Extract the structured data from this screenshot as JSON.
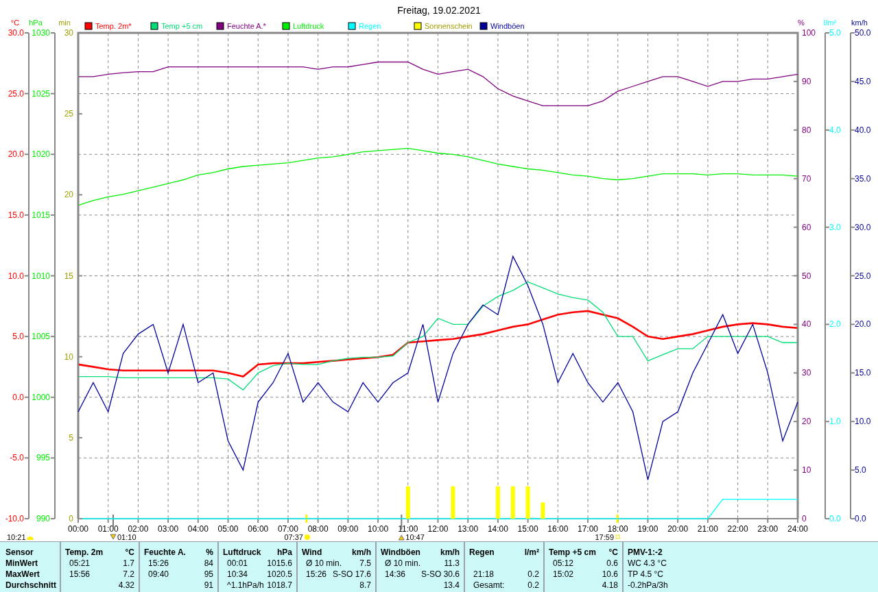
{
  "charts": [
    {
      "chart_data": {
        "type": "line",
        "title": "Freitag, 19.02.2021",
        "ylabel": "°C",
        "x": [
          0,
          0.5,
          1,
          1.5,
          2,
          2.5,
          3,
          3.5,
          4,
          4.5,
          5,
          5.5,
          6,
          6.5,
          7,
          7.5,
          8,
          8.5,
          9,
          9.5,
          10,
          10.5,
          11,
          11.5,
          12,
          12.5,
          13,
          13.5,
          14,
          14.5,
          15,
          15.5,
          16,
          16.5,
          17,
          17.5,
          18,
          18.5,
          19,
          19.5,
          20,
          20.5,
          21,
          21.5,
          22,
          22.5,
          23,
          23.5,
          24
        ],
        "xlim": [
          0,
          24
        ],
        "xticks": [
          {
            "value": 0,
            "label": "00:00"
          },
          {
            "value": 1,
            "label": "01:00"
          },
          {
            "value": 2,
            "label": "02:00"
          },
          {
            "value": 3,
            "label": "03:00"
          },
          {
            "value": 4,
            "label": "04:00"
          },
          {
            "value": 5,
            "label": "05:00"
          },
          {
            "value": 6,
            "label": "06:00"
          },
          {
            "value": 7,
            "label": "07:00"
          },
          {
            "value": 8,
            "label": "08:00"
          },
          {
            "value": 9,
            "label": "09:00"
          },
          {
            "value": 10,
            "label": "10:00"
          },
          {
            "value": 11,
            "label": "11:00"
          },
          {
            "value": 12,
            "label": "12:00"
          },
          {
            "value": 13,
            "label": "13:00"
          },
          {
            "value": 14,
            "label": "14:00"
          },
          {
            "value": 15,
            "label": "15:00"
          },
          {
            "value": 16,
            "label": "16:00"
          },
          {
            "value": 17,
            "label": "17:00"
          },
          {
            "value": 18,
            "label": "18:00"
          },
          {
            "value": 19,
            "label": "19:00"
          },
          {
            "value": 20,
            "label": "20:00"
          },
          {
            "value": 21,
            "label": "21:00"
          },
          {
            "value": 22,
            "label": "22:00"
          },
          {
            "value": 23,
            "label": "23:00"
          },
          {
            "value": 24,
            "label": "24:00"
          }
        ],
        "ylim": [
          -10,
          30
        ],
        "yticks": [
          {
            "value": -10,
            "label": "-10.0"
          },
          {
            "value": -5,
            "label": "-5.0"
          },
          {
            "value": 0,
            "label": "0.0"
          },
          {
            "value": 5,
            "label": "5.0"
          },
          {
            "value": 10,
            "label": "10.0"
          },
          {
            "value": 15,
            "label": "15.0"
          },
          {
            "value": 20,
            "label": "20.0"
          },
          {
            "value": 25,
            "label": "25.0"
          },
          {
            "value": 30,
            "label": "30.0"
          }
        ],
        "series": [
          {
            "name": "Temp. 2m*",
            "color": "#ff0000",
            "values": [
              2.7,
              2.5,
              2.3,
              2.2,
              2.2,
              2.2,
              2.2,
              2.2,
              2.2,
              2.2,
              2.0,
              1.7,
              2.7,
              2.8,
              2.8,
              2.8,
              2.9,
              3.0,
              3.1,
              3.2,
              3.3,
              3.5,
              4.5,
              4.6,
              4.7,
              4.8,
              5.0,
              5.2,
              5.5,
              5.8,
              6.0,
              6.4,
              6.8,
              7.0,
              7.1,
              6.8,
              6.5,
              5.8,
              5.0,
              4.8,
              5.0,
              5.2,
              5.5,
              5.8,
              6.0,
              6.1,
              6.0,
              5.8,
              5.7
            ]
          },
          {
            "name": "Temp +5 cm",
            "color": "#00dd77",
            "values": [
              1.7,
              1.7,
              1.7,
              1.6,
              1.6,
              1.6,
              1.6,
              1.6,
              1.6,
              1.6,
              1.5,
              0.6,
              2.0,
              2.6,
              2.8,
              2.7,
              2.7,
              3.0,
              3.2,
              3.3,
              3.3,
              3.4,
              4.5,
              5.0,
              6.5,
              6.0,
              6.0,
              7.5,
              8.3,
              8.8,
              9.5,
              9.0,
              8.5,
              8.2,
              8.0,
              7.0,
              5.0,
              5.0,
              3.0,
              3.5,
              4.0,
              4.0,
              5.0,
              5.0,
              5.0,
              5.0,
              5.0,
              4.5,
              4.5
            ]
          }
        ],
        "grid": true,
        "legend": "top"
      }
    },
    {
      "chart_data": {
        "type": "line",
        "ylabel": "%",
        "x": [
          0,
          0.5,
          1,
          1.5,
          2,
          2.5,
          3,
          3.5,
          4,
          4.5,
          5,
          5.5,
          6,
          6.5,
          7,
          7.5,
          8,
          8.5,
          9,
          9.5,
          10,
          10.5,
          11,
          11.5,
          12,
          12.5,
          13,
          13.5,
          14,
          14.5,
          15,
          15.5,
          16,
          16.5,
          17,
          17.5,
          18,
          18.5,
          19,
          19.5,
          20,
          20.5,
          21,
          21.5,
          22,
          22.5,
          23,
          23.5,
          24
        ],
        "xlim": [
          0,
          24
        ],
        "ylim": [
          0,
          100
        ],
        "yticks": [
          0,
          10,
          20,
          30,
          40,
          50,
          60,
          70,
          80,
          90,
          100
        ],
        "series": [
          {
            "name": "Feuchte A.*",
            "color": "#800080",
            "values": [
              91,
              91,
              91.5,
              91.8,
              92,
              92,
              93,
              93,
              93,
              93,
              93,
              93,
              93,
              93,
              93,
              93,
              92.5,
              93,
              93,
              93.5,
              94,
              94,
              94,
              92.5,
              91.5,
              92,
              92.5,
              91,
              88.5,
              87,
              86,
              85,
              85,
              85,
              85,
              86,
              88,
              89,
              90,
              91,
              91,
              90,
              89,
              90,
              90,
              90.5,
              90.5,
              91,
              91.5
            ]
          }
        ]
      }
    },
    {
      "chart_data": {
        "type": "line",
        "ylabel": "hPa",
        "x": [
          0,
          0.5,
          1,
          1.5,
          2,
          2.5,
          3,
          3.5,
          4,
          4.5,
          5,
          5.5,
          6,
          6.5,
          7,
          7.5,
          8,
          8.5,
          9,
          9.5,
          10,
          10.5,
          11,
          11.5,
          12,
          12.5,
          13,
          13.5,
          14,
          14.5,
          15,
          15.5,
          16,
          16.5,
          17,
          17.5,
          18,
          18.5,
          19,
          19.5,
          20,
          20.5,
          21,
          21.5,
          22,
          22.5,
          23,
          23.5,
          24
        ],
        "xlim": [
          0,
          24
        ],
        "ylim": [
          990,
          1030
        ],
        "yticks": [
          990,
          995,
          1000,
          1005,
          1010,
          1015,
          1020,
          1025,
          1030
        ],
        "series": [
          {
            "name": "Luftdruck",
            "color": "#00ee00",
            "values": [
              1015.8,
              1016.2,
              1016.5,
              1016.7,
              1017,
              1017.3,
              1017.6,
              1017.9,
              1018.3,
              1018.5,
              1018.8,
              1019,
              1019.1,
              1019.2,
              1019.3,
              1019.5,
              1019.7,
              1019.8,
              1020,
              1020.2,
              1020.3,
              1020.4,
              1020.5,
              1020.3,
              1020.1,
              1020,
              1019.8,
              1019.5,
              1019.2,
              1019,
              1018.8,
              1018.7,
              1018.5,
              1018.3,
              1018.2,
              1018,
              1017.9,
              1018,
              1018.2,
              1018.4,
              1018.4,
              1018.4,
              1018.3,
              1018.4,
              1018.4,
              1018.3,
              1018.3,
              1018.3,
              1018.2
            ]
          }
        ]
      }
    },
    {
      "chart_data": {
        "type": "line",
        "ylabel": "l/m²",
        "x": [
          0,
          0.5,
          1,
          1.5,
          2,
          2.5,
          3,
          3.5,
          4,
          4.5,
          5,
          5.5,
          6,
          6.5,
          7,
          7.5,
          8,
          8.5,
          9,
          9.5,
          10,
          10.5,
          11,
          11.5,
          12,
          12.5,
          13,
          13.5,
          14,
          14.5,
          15,
          15.5,
          16,
          16.5,
          17,
          17.5,
          18,
          18.5,
          19,
          19.5,
          20,
          20.5,
          21,
          21.5,
          22,
          22.5,
          23,
          23.5,
          24
        ],
        "xlim": [
          0,
          24
        ],
        "ylim": [
          0,
          5
        ],
        "yticks": [
          {
            "value": 0,
            "label": "0.0"
          },
          {
            "value": 1,
            "label": "1.0"
          },
          {
            "value": 2,
            "label": "2.0"
          },
          {
            "value": 3,
            "label": "3.0"
          },
          {
            "value": 4,
            "label": "4.0"
          },
          {
            "value": 5,
            "label": "5.0"
          }
        ],
        "series": [
          {
            "name": "Regen",
            "color": "#00ffff",
            "values": [
              0,
              0,
              0,
              0,
              0,
              0,
              0,
              0,
              0,
              0,
              0,
              0,
              0,
              0,
              0,
              0,
              0,
              0,
              0,
              0,
              0,
              0,
              0,
              0,
              0,
              0,
              0,
              0,
              0,
              0,
              0,
              0,
              0,
              0,
              0,
              0,
              0,
              0,
              0,
              0,
              0,
              0,
              0,
              0.2,
              0.2,
              0.2,
              0.2,
              0.2,
              0.2
            ]
          }
        ]
      }
    },
    {
      "chart_data": {
        "type": "bar",
        "ylabel": "min",
        "x": [
          11,
          12.5,
          14,
          14.5,
          15,
          15.5
        ],
        "xlim": [
          0,
          24
        ],
        "ylim": [
          0,
          30
        ],
        "yticks": [
          0,
          5,
          10,
          15,
          20,
          25,
          30
        ],
        "series": [
          {
            "name": "Sonnenschein",
            "color": "#ffff00",
            "values": [
              2,
              2,
              2,
              2,
              2,
              1
            ]
          }
        ]
      }
    },
    {
      "chart_data": {
        "type": "line",
        "ylabel": "km/h",
        "x": [
          0,
          0.5,
          1,
          1.5,
          2,
          2.5,
          3,
          3.5,
          4,
          4.5,
          5,
          5.5,
          6,
          6.5,
          7,
          7.5,
          8,
          8.5,
          9,
          9.5,
          10,
          10.5,
          11,
          11.5,
          12,
          12.5,
          13,
          13.5,
          14,
          14.5,
          15,
          15.5,
          16,
          16.5,
          17,
          17.5,
          18,
          18.5,
          19,
          19.5,
          20,
          20.5,
          21,
          21.5,
          22,
          22.5,
          23,
          23.5,
          24
        ],
        "xlim": [
          0,
          24
        ],
        "ylim": [
          0,
          50
        ],
        "yticks": [
          {
            "value": 0,
            "label": "0.0"
          },
          {
            "value": 5,
            "label": "5.0"
          },
          {
            "value": 10,
            "label": "10.0"
          },
          {
            "value": 15,
            "label": "15.0"
          },
          {
            "value": 20,
            "label": "20.0"
          },
          {
            "value": 25,
            "label": "25.0"
          },
          {
            "value": 30,
            "label": "30.0"
          },
          {
            "value": 35,
            "label": "35.0"
          },
          {
            "value": 40,
            "label": "40.0"
          },
          {
            "value": 45,
            "label": "45.0"
          },
          {
            "value": 50,
            "label": "50.0"
          }
        ],
        "series": [
          {
            "name": "Windböen",
            "color": "#000099",
            "values": [
              11,
              14,
              11,
              17,
              19,
              20,
              15,
              20,
              14,
              15,
              8,
              5,
              12,
              14,
              17,
              12,
              14,
              12,
              11,
              14,
              12,
              14,
              15,
              20,
              12,
              17,
              20,
              22,
              21,
              27,
              24,
              20,
              14,
              17,
              14,
              12,
              14,
              11,
              4,
              10,
              11,
              15,
              18,
              21,
              17,
              20,
              15,
              8,
              12
            ]
          }
        ]
      }
    }
  ],
  "events": [
    {
      "kind": "moonset",
      "time": "01:10"
    },
    {
      "kind": "sunrise",
      "time": "07:37"
    },
    {
      "kind": "moonrise",
      "time": "10:47"
    },
    {
      "kind": "sunset",
      "time": "17:59"
    }
  ],
  "day_length": {
    "label": "10:21"
  },
  "table": {
    "row_header": {
      "title": "Sensor",
      "rows": [
        "MinWert",
        "MaxWert",
        "Durchschnitt"
      ]
    },
    "columns": [
      {
        "title": "Temp. 2m",
        "unit": "°C",
        "rows": [
          {
            "time": "05:21",
            "value": "1.7"
          },
          {
            "time": "15:56",
            "value": "7.2"
          },
          {
            "value": "4.32"
          }
        ]
      },
      {
        "title": "Feuchte A.",
        "unit": "%",
        "rows": [
          {
            "time": "15:26",
            "value": "84"
          },
          {
            "time": "09:40",
            "value": "95"
          },
          {
            "value": "91"
          }
        ]
      },
      {
        "title": "Luftdruck",
        "unit": "hPa",
        "rows": [
          {
            "time": "00:01",
            "value": "1015.6"
          },
          {
            "time": "10:34",
            "value": "1020.5"
          },
          {
            "time": "^1.1hPa/h",
            "value": "1018.7"
          }
        ]
      },
      {
        "title": "Wind",
        "unit": "km/h",
        "rows": [
          {
            "time": "Ø 10 min.",
            "value": "7.5"
          },
          {
            "time": "15:26",
            "value": "S-SO 17.6"
          },
          {
            "value": "8.7"
          }
        ]
      },
      {
        "title": "Windböen",
        "unit": "km/h",
        "rows": [
          {
            "time": "Ø 10 min.",
            "value": "11.3"
          },
          {
            "time": "14:36",
            "value": "S-SO 30.6"
          },
          {
            "value": "13.4"
          }
        ]
      },
      {
        "title": "Regen",
        "unit": "l/m²",
        "rows": [
          {},
          {
            "time": "21:18",
            "value": "0.2"
          },
          {
            "time": "Gesamt:",
            "value": "0.2"
          }
        ]
      },
      {
        "title": "Temp +5 cm",
        "unit": "°C",
        "rows": [
          {
            "time": "05:12",
            "value": "0.6"
          },
          {
            "time": "15:02",
            "value": "10.6"
          },
          {
            "value": "4.18"
          }
        ]
      }
    ],
    "extra": {
      "title": "PMV-1:-2",
      "lines": [
        "WC 4.3 °C",
        "TP 4.5 °C",
        "-0.2hPa/3h"
      ]
    }
  }
}
